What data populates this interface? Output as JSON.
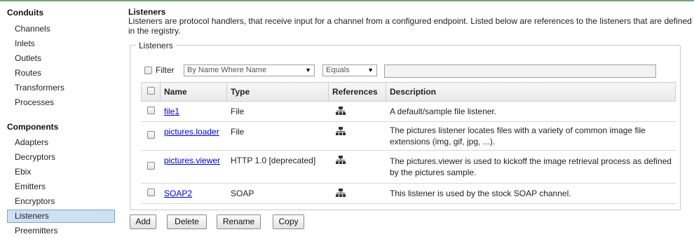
{
  "sidebar": {
    "conduits_title": "Conduits",
    "conduits": [
      "Channels",
      "Inlets",
      "Outlets",
      "Routes",
      "Transformers",
      "Processes"
    ],
    "components_title": "Components",
    "components": [
      "Adapters",
      "Decryptors",
      "Ebix",
      "Emitters",
      "Encryptors",
      "Listeners",
      "Preemitters"
    ],
    "selected": "Listeners"
  },
  "page": {
    "title": "Listeners",
    "description": "Listeners are protocol handlers, that receive input for a channel from a configured endpoint. Listed below are references to the listeners that are defined in the registry."
  },
  "group": {
    "legend": "Listeners",
    "filter": {
      "label": "Filter",
      "checked": false,
      "field_value": "By Name Where Name",
      "operator_value": "Equals",
      "text_value": ""
    },
    "columns": [
      "Name",
      "Type",
      "References",
      "Description"
    ],
    "rows": [
      {
        "name": "file1",
        "type": "File",
        "reference_icon": "references-icon",
        "description": "A default/sample file listener."
      },
      {
        "name": "pictures.loader",
        "type": "File",
        "reference_icon": "references-icon",
        "description": "The pictures listener locates files with a variety of common image file extensions (img, gif, jpg, ...)."
      },
      {
        "name": "pictures.viewer",
        "type": "HTTP 1.0 [deprecated]",
        "reference_icon": "references-icon",
        "description": "The pictures.viewer is used to kickoff the image retrieval process as defined by the pictures sample."
      },
      {
        "name": "SOAP2",
        "type": "SOAP",
        "reference_icon": "references-icon",
        "description": "This listener is used by the stock SOAP channel."
      }
    ]
  },
  "buttons": {
    "add": "Add",
    "delete": "Delete",
    "rename": "Rename",
    "copy": "Copy"
  },
  "colors": {
    "selected_bg": "#cfe0f3",
    "link": "#0000cc",
    "top_border": "#6fa86f"
  }
}
